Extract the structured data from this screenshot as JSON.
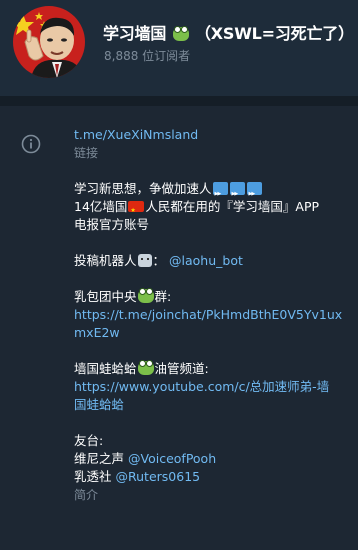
{
  "channel": {
    "title": "学习墙国",
    "title_suffix": "（XSWL=习死亡了）",
    "subscribers": "8,888 位订阅者"
  },
  "link": {
    "url": "t.me/XueXiNmsland",
    "caption": "链接"
  },
  "description": {
    "line1": "学习新思想，争做加速人",
    "line2_a": "14亿墙国",
    "line2_b": "人民都在用的『学习墙国』APP",
    "line3": "电报官方账号",
    "bot_label": "投稿机器人",
    "bot_sep": "：",
    "bot_handle": "@laohu_bot",
    "group_label_a": "乳包团中央",
    "group_label_b": "群:",
    "group_link_1": "https://t.me/joinchat/PkHmdBthE0V5Yv1ux",
    "group_link_2": "mxE2w",
    "youtube_label_a": "墙国蛙蛤蛤",
    "youtube_label_b": "油管频道:",
    "youtube_link_1": "https://www.youtube.com/c/总加速师弟-墙",
    "youtube_link_2": "国蛙蛤蛤",
    "friends_label": "友台:",
    "friend1_name": "维尼之声",
    "friend1_handle": "@VoiceofPooh",
    "friend2_name": "乳透社",
    "friend2_handle": "@Ruters0615",
    "caption": "简介"
  },
  "colors": {
    "background": "#1d2733",
    "header": "#1e2c3a",
    "link": "#71baf2",
    "muted": "#7d8b99",
    "flag_red": "#de2910"
  },
  "icons": {
    "info": "info-icon",
    "frog": "frog-emoji",
    "fast_forward": "fast-forward-emoji",
    "flag": "china-flag-emoji",
    "robot": "robot-emoji"
  }
}
